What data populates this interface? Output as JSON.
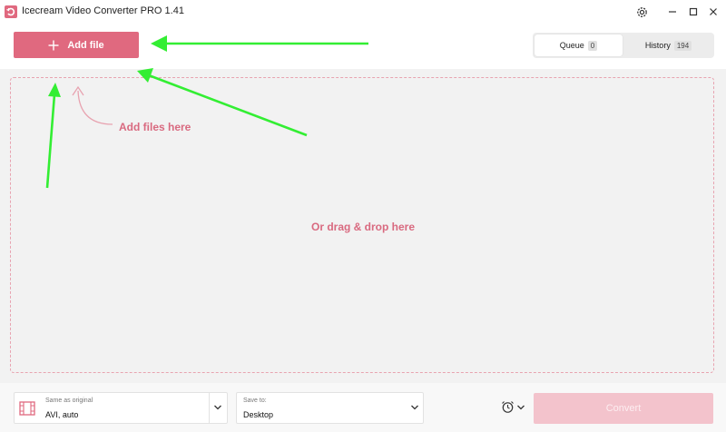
{
  "app": {
    "title": "Icecream Video Converter PRO 1.41"
  },
  "header": {
    "add_file_label": "Add file"
  },
  "tabs": [
    {
      "label": "Queue",
      "count": "0"
    },
    {
      "label": "History",
      "count": "194"
    }
  ],
  "dropzone": {
    "hint": "Add files here",
    "drag_text": "Or drag & drop here"
  },
  "footer": {
    "format_caption": "Same as original",
    "format_value": "AVI, auto",
    "save_caption": "Save to:",
    "save_value": "Desktop",
    "convert_label": "Convert"
  },
  "colors": {
    "accent": "#e0697f",
    "accent_disabled": "#f3c3cc",
    "annotation": "#33ee33"
  },
  "icons": [
    "app-logo-icon",
    "gear-icon",
    "minimize-icon",
    "maximize-icon",
    "close-icon",
    "plus-icon",
    "film-icon",
    "chevron-down-icon",
    "alarm-clock-icon"
  ]
}
